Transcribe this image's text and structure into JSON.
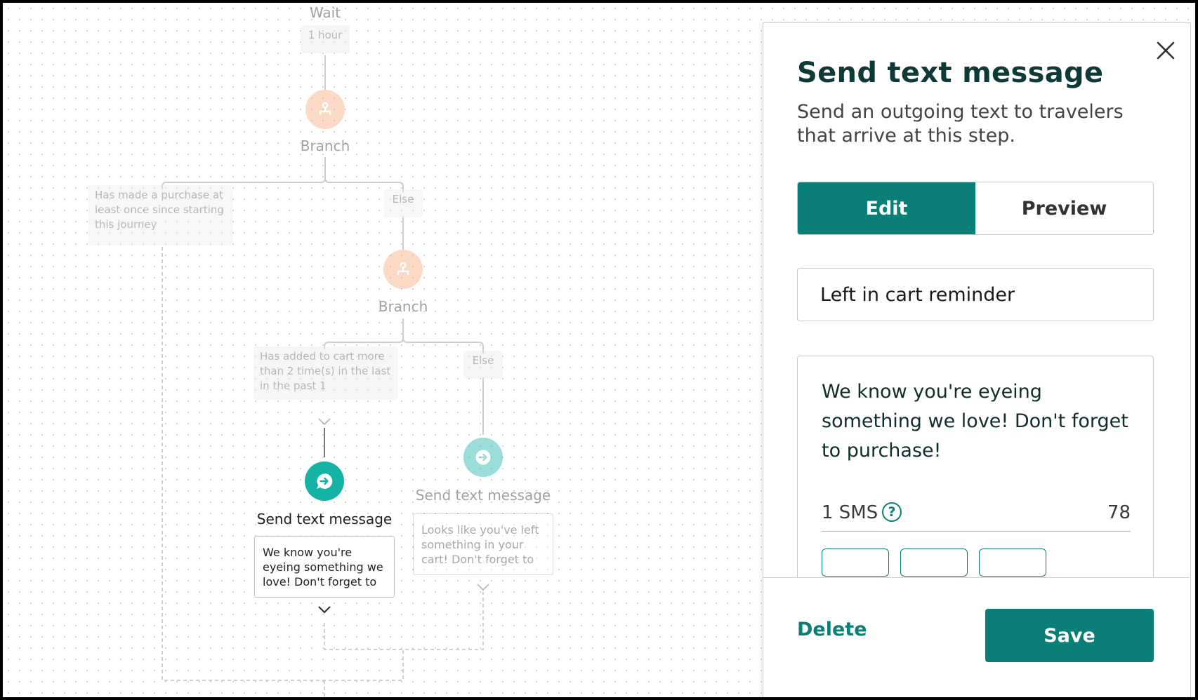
{
  "flow": {
    "wait": {
      "label": "Wait",
      "duration": "1 hour"
    },
    "branch1": {
      "label": "Branch",
      "condition": "Has made a purchase at least once since starting this journey",
      "else_label": "Else"
    },
    "branch2": {
      "label": "Branch",
      "condition": "Has added to cart more than 2 time(s) in the last in the past 1",
      "else_label": "Else"
    },
    "send_active": {
      "label": "Send text message",
      "preview": "We know you're eyeing something we love! Don't forget to"
    },
    "send_faded": {
      "label": "Send text message",
      "preview": "Looks like you've left something in your cart! Don't forget to"
    }
  },
  "panel": {
    "title": "Send text message",
    "description": "Send an outgoing text to travelers that arrive at this step.",
    "tabs": [
      {
        "label": "Edit",
        "active": true
      },
      {
        "label": "Preview",
        "active": false
      }
    ],
    "name_value": "Left in cart reminder",
    "message_value": "We know you're eyeing something we love! Don't forget to purchase!",
    "sms_count": "1 SMS",
    "help_symbol": "?",
    "char_count": "78",
    "delete_label": "Delete",
    "save_label": "Save"
  },
  "colors": {
    "teal": "#0a7f77",
    "teal_node": "#14b3a6",
    "branch_node": "#f7a777",
    "dark_text": "#0d3a36"
  },
  "icons": [
    "branch-icon",
    "message-arrow-icon",
    "close-icon",
    "chevron-down-icon",
    "help-icon"
  ]
}
